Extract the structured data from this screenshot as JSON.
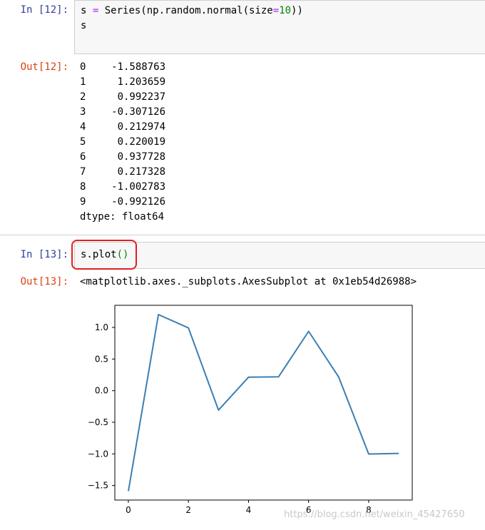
{
  "cells": {
    "in12": {
      "prompt": "In  [12]:",
      "line1": {
        "ident": "s ",
        "eq": "=",
        "call": " Series(np.random.normal(size",
        "eq2": "=",
        "num": "10",
        "close": "))"
      },
      "line2": "s"
    },
    "out12": {
      "prompt": "Out[12]:",
      "rows": [
        {
          "index": "0",
          "value": "-1.588763"
        },
        {
          "index": "1",
          "value": "1.203659"
        },
        {
          "index": "2",
          "value": "0.992237"
        },
        {
          "index": "3",
          "value": "-0.307126"
        },
        {
          "index": "4",
          "value": "0.212974"
        },
        {
          "index": "5",
          "value": "0.220019"
        },
        {
          "index": "6",
          "value": "0.937728"
        },
        {
          "index": "7",
          "value": "0.217328"
        },
        {
          "index": "8",
          "value": "-1.002783"
        },
        {
          "index": "9",
          "value": "-0.992126"
        }
      ],
      "dtype": "dtype: float64"
    },
    "in13": {
      "prompt": "In  [13]:",
      "code": "s.plot",
      "parens": "()"
    },
    "out13": {
      "prompt": "Out[13]:",
      "text": "<matplotlib.axes._subplots.AxesSubplot at 0x1eb54d26988>"
    }
  },
  "chart_data": {
    "type": "line",
    "x": [
      0,
      1,
      2,
      3,
      4,
      5,
      6,
      7,
      8,
      9
    ],
    "series": [
      {
        "values": [
          -1.588763,
          1.203659,
          0.992237,
          -0.307126,
          0.212974,
          0.220019,
          0.937728,
          0.217328,
          -1.002783,
          -0.992126
        ],
        "color": "#3a7fb4"
      }
    ],
    "xlim": [
      -0.45,
      9.45
    ],
    "ylim": [
      -1.73,
      1.35
    ],
    "xticks": [
      "0",
      "2",
      "4",
      "6",
      "8"
    ],
    "yticks": [
      "1.0",
      "0.5",
      "0.0",
      "−0.5",
      "−1.0",
      "−1.5"
    ],
    "title": "",
    "xlabel": "",
    "ylabel": ""
  },
  "watermark": "https://blog.csdn.net/weixin_45427650",
  "colors": {
    "in_prompt": "#303f9f",
    "out_prompt": "#d84315",
    "highlight": "#e02020"
  }
}
